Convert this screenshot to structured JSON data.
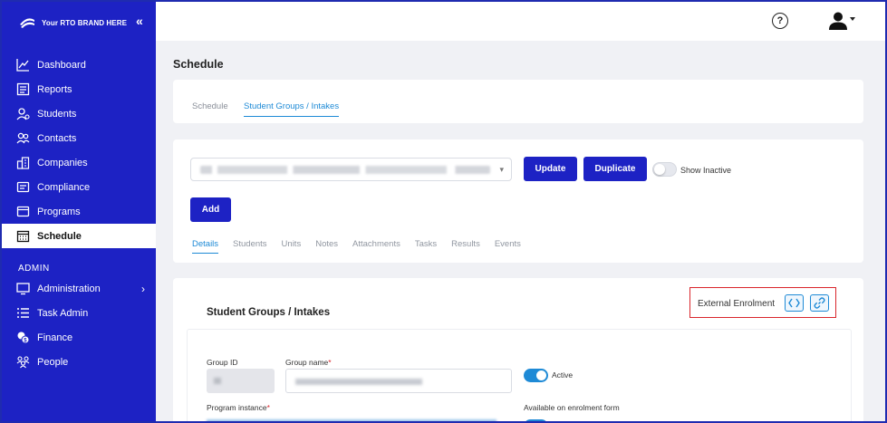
{
  "sidebar": {
    "brand": "Your RTO BRAND HERE",
    "collapse_icon": "double-chevron-left-icon",
    "items": [
      {
        "label": "Dashboard",
        "icon": "chart-line-icon"
      },
      {
        "label": "Reports",
        "icon": "report-icon"
      },
      {
        "label": "Students",
        "icon": "students-icon"
      },
      {
        "label": "Contacts",
        "icon": "contacts-icon"
      },
      {
        "label": "Companies",
        "icon": "companies-icon"
      },
      {
        "label": "Compliance",
        "icon": "compliance-icon"
      },
      {
        "label": "Programs",
        "icon": "programs-icon"
      },
      {
        "label": "Schedule",
        "icon": "calendar-icon",
        "active": true
      }
    ],
    "admin_section": "ADMIN",
    "admin_items": [
      {
        "label": "Administration",
        "icon": "monitor-icon",
        "has_submenu": true
      },
      {
        "label": "Task Admin",
        "icon": "list-icon"
      },
      {
        "label": "Finance",
        "icon": "finance-icon"
      },
      {
        "label": "People",
        "icon": "people-icon"
      }
    ]
  },
  "topbar": {
    "help_icon": "help-icon",
    "user_icon": "user-icon"
  },
  "page": {
    "title": "Schedule"
  },
  "top_tabs": [
    {
      "label": "Schedule",
      "active": false
    },
    {
      "label": "Student Groups / Intakes",
      "active": true
    }
  ],
  "controls": {
    "update_label": "Update",
    "duplicate_label": "Duplicate",
    "show_inactive_label": "Show Inactive",
    "show_inactive": false,
    "add_label": "Add"
  },
  "sub_tabs": [
    {
      "label": "Details",
      "active": true
    },
    {
      "label": "Students",
      "active": false
    },
    {
      "label": "Units",
      "active": false
    },
    {
      "label": "Notes",
      "active": false
    },
    {
      "label": "Attachments",
      "active": false
    },
    {
      "label": "Tasks",
      "active": false
    },
    {
      "label": "Results",
      "active": false
    },
    {
      "label": "Events",
      "active": false
    }
  ],
  "section": {
    "title": "Student Groups / Intakes",
    "external_enrolment_label": "External Enrolment"
  },
  "form": {
    "group_id_label": "Group ID",
    "group_name_label": "Group name",
    "active_label": "Active",
    "active": true,
    "program_instance_label": "Program instance",
    "available_label": "Available on enrolment form",
    "available": true
  }
}
